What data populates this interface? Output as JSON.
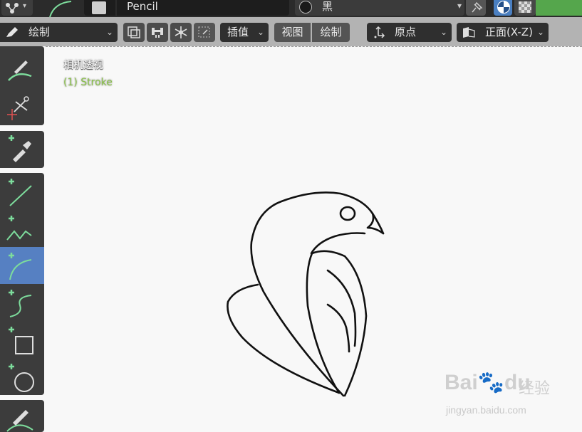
{
  "row1": {
    "material_name": "Pencil",
    "color_name": "黑"
  },
  "header": {
    "mode_label": "绘制",
    "interpolate_label": "插值",
    "view_label": "视图",
    "draw_label": "绘制",
    "origin_label": "原点",
    "orientation_label": "正面(X-Z)"
  },
  "viewport": {
    "camera_label": "相机透视",
    "object_label": "(1) Stroke"
  },
  "toolbar": {
    "tools": [
      "draw",
      "cutter",
      "eyedropper",
      "line",
      "polyline",
      "arc",
      "curve",
      "box",
      "circle",
      "annotate"
    ],
    "active_tool": "arc"
  },
  "watermark": {
    "logo_text": "Bai",
    "logo_text2": "du",
    "logo_cn": "经验",
    "url": "jingyan.baidu.com"
  },
  "colors": {
    "accent": "#5680c2",
    "header_bg": "#b3b3b3",
    "object_label": "#8bc34a",
    "tool_bg": "#3c3c3c"
  }
}
